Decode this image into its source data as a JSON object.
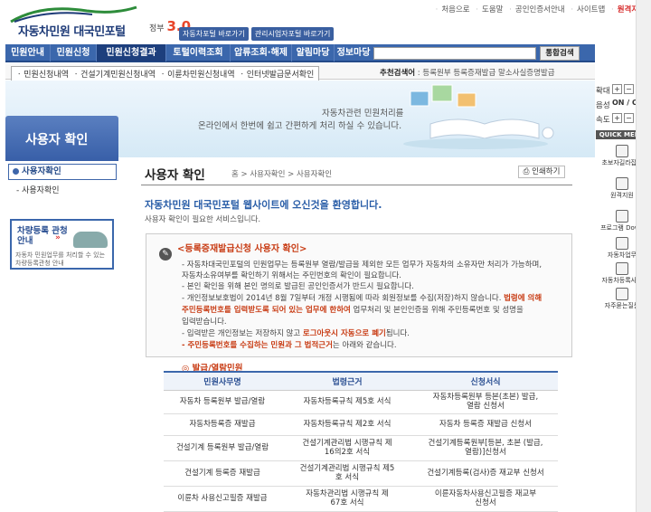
{
  "header": {
    "logo_title": "자동차민원 대국민포털",
    "gov_logo_prefix": "정부",
    "gov_logo_num": "3.0",
    "portal_links": [
      "자동차포털 바로가기",
      "관리시업자포털 바로가기"
    ],
    "util_links": [
      "처음으로",
      "도움말",
      "공인인증서안내",
      "사이트맵"
    ],
    "util_highlight": "원격지원"
  },
  "gnb": {
    "items": [
      "민원안내",
      "민원신청",
      "민원신청결과",
      "토털이력조회",
      "압류조회·해제",
      "알림마당",
      "정보마당"
    ],
    "active_index": 2,
    "search_placeholder": "",
    "search_button": "통합검색"
  },
  "subnav": {
    "items": [
      "민원신청내역",
      "건설기계민원신청내역",
      "이륜차민원신청내역",
      "인터넷발급문서확인"
    ],
    "reco_label": "추천검색어",
    "reco_items": [
      "등록원부",
      "등록증재발급",
      "말소사실증명발급"
    ]
  },
  "banner": {
    "line1": "자동차관련 민원처리를",
    "line2": "온라인에서 한번에 쉽고 간편하게 처리 하실 수 있습니다."
  },
  "side": {
    "title": "사용자 확인",
    "items": [
      "사용자확인",
      "사용자확인"
    ],
    "promo_title": "차량등록 관청 안내",
    "promo_arrow": "»",
    "promo_desc": [
      "자동차 민원업무를 처리할 수 있는",
      "차량등록관청 안내"
    ]
  },
  "content": {
    "title": "사용자 확인",
    "breadcrumb": "홈 > 사용자확인 > 사용자확인",
    "print_label": "인쇄하기",
    "welcome": "자동차민원 대국민포털 웹사이트에 오신것을 환영합니다.",
    "welcome_sub": "사용자 확인이 필요한 서비스입니다.",
    "notice_title": "<등록증재발급신청 사용자 확인>",
    "notice_lines": [
      "- 자동차대국민포털의 민원업무는 등록원부 열람/발급을 제외한 모든 업무가 자동차의 소유자만 처리가 가능하며,",
      "자동차소유여부를 확인하기 위해서는 주민번호의 확인이 필요합니다.",
      "- 본인 확인을 위해 본인 명의로 발급된 공인인증서가 반드시 필요합니다.",
      "- 개인정보보호법이 2014년 8월 7일부터 개정 시행됨에 따라 회원정보를 수집(저장)하지 않습니다.",
      "법령에 의해",
      "주민등록번호를 입력받도록 되어 있는 업무에 한하여",
      "업무처리 및 본인인증을 위해 주민등록번호 및 성명을",
      "입력받습니다.",
      "- 입력받은 개인정보는 저장하지 않고",
      "로그아웃시 자동으로 폐기",
      "됩니다.",
      "- 주민등록번호를 수집하는 민원과 그 법적근거",
      "는 아래와 같습니다."
    ],
    "section_title": "발급/열람민원",
    "table_headers": [
      "민원사무명",
      "법령근거",
      "신청서식"
    ],
    "table_rows": [
      [
        "자동차 등록원부 발급/열람",
        "자동차등록규칙 제5호 서식",
        "자동차등록원부 등본(초본) 발급,열람 신청서"
      ],
      [
        "자동차등록증 재발급",
        "자동차등록규칙 제2호 서식",
        "자동차 등록증 재발급 신청서"
      ],
      [
        "건설기계 등록원부 발급/열람",
        "건설기계관리법 시행규칙 제16의2호 서식",
        "건설기계등록원부[등본, 초본 (발급,열람)]신청서"
      ],
      [
        "건설기계 등록증 재발급",
        "건설기계관리법 시행규칙 제5호 서식",
        "건설기계등록(검사)증 재교부 신청서"
      ],
      [
        "이륜차 사용신고필증 재발급",
        "자동차관리법 시행규칙 제67호 서식",
        "이륜자동차사용신고필증 재교부신청서"
      ]
    ]
  },
  "right_panel": {
    "zoom_label": "확대",
    "reduce_label": "축소",
    "sound_label": "음성",
    "on_off": "ON / OFF",
    "speed_label": "속도",
    "quick_title": "QUICK MENU",
    "quick_items": [
      "초보자길라잡이",
      "원격지원",
      "프로그램 Down",
      "자동차업무",
      "자동차등록사전",
      "자주묻는질문"
    ]
  }
}
